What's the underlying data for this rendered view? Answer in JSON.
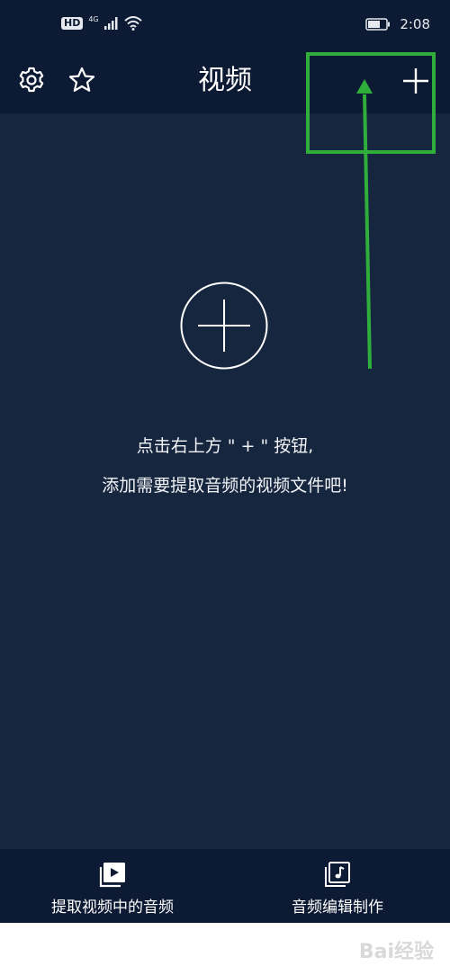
{
  "status_bar": {
    "hd": "HD",
    "network": "4G",
    "time": "2:08"
  },
  "header": {
    "title": "视频",
    "icons": [
      "settings-icon",
      "star-icon",
      "plus-icon"
    ]
  },
  "main": {
    "add_icon": "plus-circle-icon",
    "hint_line1": "点击右上方 \" + \" 按钮,",
    "hint_line2": "添加需要提取音频的视频文件吧!"
  },
  "bottom_nav": {
    "items": [
      {
        "label": "提取视频中的音频",
        "icon": "video-play-icon"
      },
      {
        "label": "音频编辑制作",
        "icon": "music-note-icon"
      }
    ]
  },
  "watermark": "Bai经验",
  "colors": {
    "header_bg": "#0d1a33",
    "main_bg": "#16263f",
    "annotation": "#2fae3b"
  }
}
